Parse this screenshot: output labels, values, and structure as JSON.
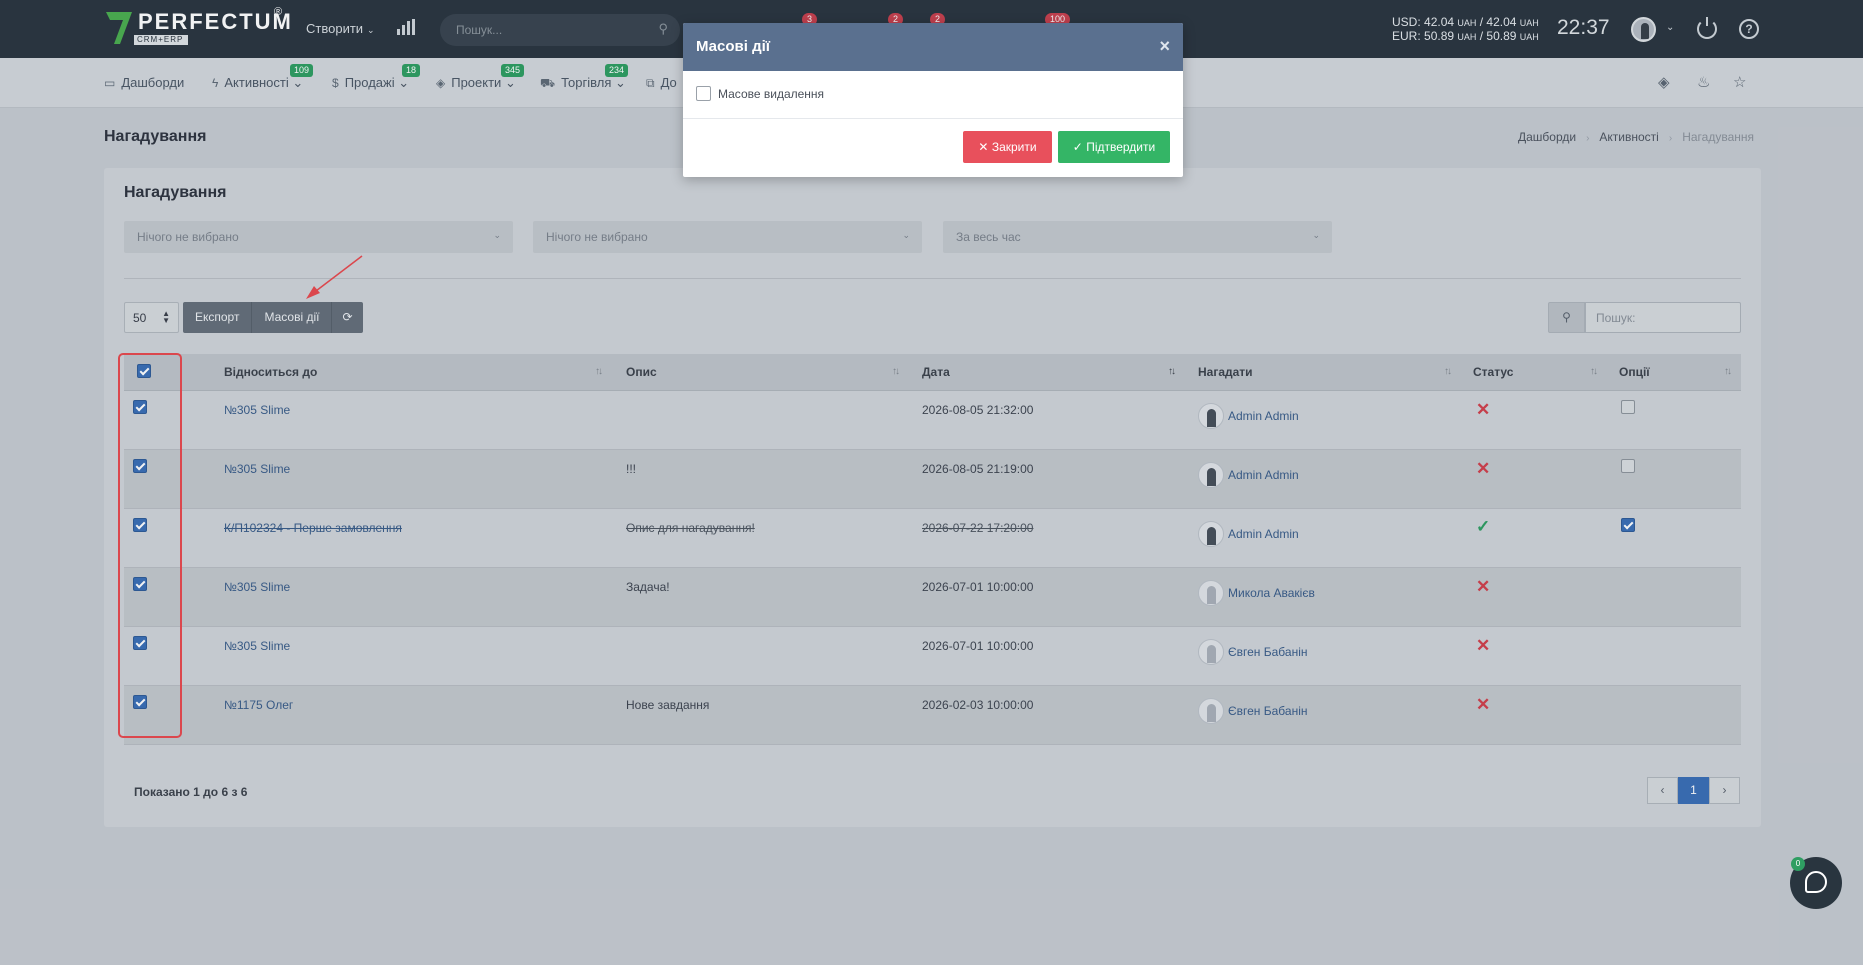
{
  "topbar": {
    "logo_text": "PERFECTUM",
    "logo_sub": "CRM+ERP",
    "logo_reg": "®",
    "create_label": "Створити",
    "search_placeholder": "Пошук...",
    "badges": [
      "3",
      "2",
      "2",
      "100"
    ],
    "currency_usd_label": "USD:",
    "currency_usd_buy": "42.04",
    "currency_usd_sell": "42.04",
    "currency_eur_label": "EUR:",
    "currency_eur_buy": "50.89",
    "currency_eur_sell": "50.89",
    "currency_unit": "UAH",
    "time": "22:37"
  },
  "nav": {
    "items": [
      {
        "label": "Дашборди",
        "badge": ""
      },
      {
        "label": "Активності",
        "badge": "109"
      },
      {
        "label": "Продажі",
        "badge": "18"
      },
      {
        "label": "Проекти",
        "badge": "345"
      },
      {
        "label": "Торгівля",
        "badge": "234"
      },
      {
        "label": "До",
        "badge": ""
      }
    ]
  },
  "page": {
    "title": "Нагадування",
    "breadcrumb": [
      "Дашборди",
      "Активності",
      "Нагадування"
    ]
  },
  "panel": {
    "title": "Нагадування",
    "filters": [
      "Нічого не вибрано",
      "Нічого не вибрано",
      "За весь час"
    ],
    "per_page": "50",
    "buttons": {
      "export": "Експорт",
      "mass_actions": "Масові дії"
    },
    "search_placeholder": "Пошук:"
  },
  "table": {
    "columns": [
      "Відноситься до",
      "Опис",
      "Дата",
      "Нагадати",
      "Статус",
      "Опції"
    ],
    "rows": [
      {
        "relates": "№305 Slime",
        "desc": "",
        "date": "2026-08-05 21:32:00",
        "user": "Admin Admin",
        "status": "x",
        "option": false,
        "done": false
      },
      {
        "relates": "№305 Slime",
        "desc": "!!!",
        "date": "2026-08-05 21:19:00",
        "user": "Admin Admin",
        "status": "x",
        "option": false,
        "done": false
      },
      {
        "relates": "К/П102324 - Перше замовлення",
        "desc": "Опис для нагадування!",
        "date": "2026-07-22 17:20:00",
        "user": "Admin Admin",
        "status": "ok",
        "option": true,
        "done": true
      },
      {
        "relates": "№305 Slime",
        "desc": "Задача!",
        "date": "2026-07-01 10:00:00",
        "user": "Микола Авакієв",
        "status": "x",
        "option": null,
        "done": false
      },
      {
        "relates": "№305 Slime",
        "desc": "",
        "date": "2026-07-01 10:00:00",
        "user": "Євген Бабанін",
        "status": "x",
        "option": null,
        "done": false
      },
      {
        "relates": "№1175 Олег",
        "desc": "Нове завдання",
        "date": "2026-02-03 10:00:00",
        "user": "Євген Бабанін",
        "status": "x",
        "option": null,
        "done": false
      }
    ]
  },
  "footer": {
    "shown": "Показано 1 до 6 з 6",
    "pages": [
      "‹",
      "1",
      "›"
    ]
  },
  "modal": {
    "title": "Масові дії",
    "close": "×",
    "checkbox_label": "Масове видалення",
    "cancel_label": "Закрити",
    "confirm_label": "Підтвердити"
  },
  "chat": {
    "badge": "0"
  },
  "colors": {
    "accent": "#3b6fb6",
    "danger": "#e8505c",
    "success": "#34b566",
    "modal_header": "#5a708f",
    "topbar": "#2b3640"
  }
}
